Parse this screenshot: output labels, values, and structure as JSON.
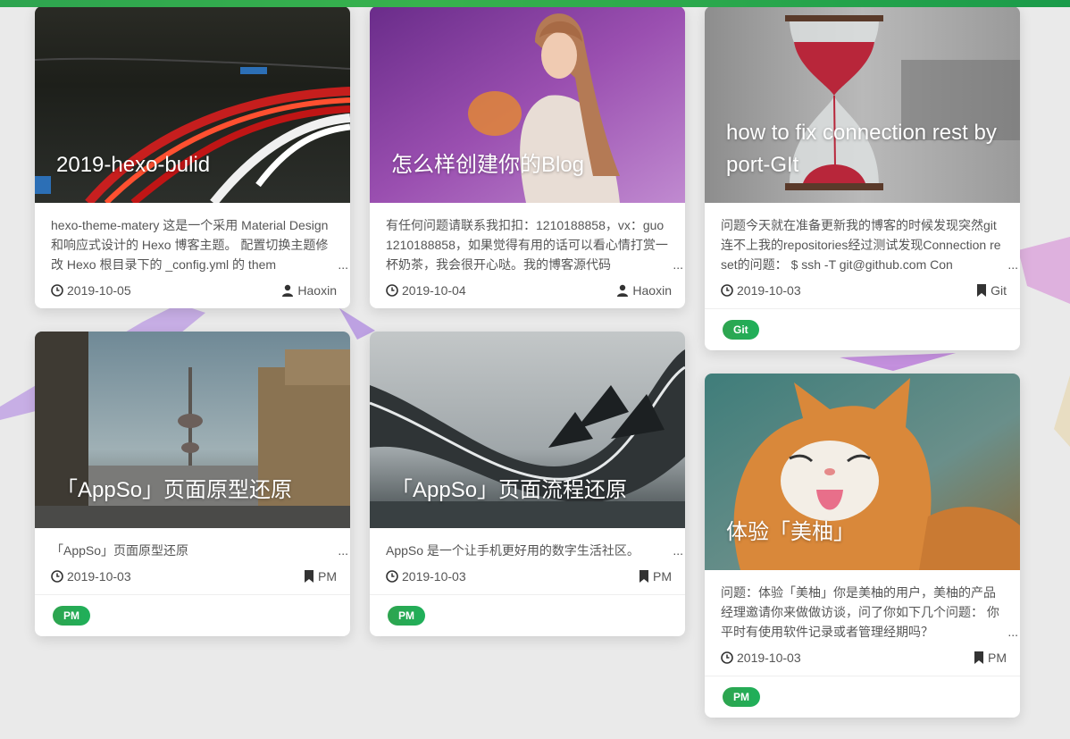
{
  "theme": {
    "accent": "#2ea44f",
    "tag_color": "#27ae60"
  },
  "cards": [
    {
      "title": "2019-hexo-bulid",
      "excerpt": "hexo-theme-matery 这是一个采用 Material Design 和响应式设计的 Hexo 博客主题。 配置切换主题修改 Hexo 根目录下的 _config.yml 的 them",
      "date": "2019-10-05",
      "meta_right": "Haoxin",
      "meta_icon": "user-icon",
      "tags": []
    },
    {
      "title": "怎么样创建你的Blog",
      "excerpt": "有任何问题请联系我扣扣：1210188858，vx：guo1210188858，如果觉得有用的话可以看心情打赏一杯奶茶，我会很开心哒。我的博客源代码",
      "date": "2019-10-04",
      "meta_right": "Haoxin",
      "meta_icon": "user-icon",
      "tags": []
    },
    {
      "title": "how to fix connection rest by port-GIt",
      "excerpt": "问题今天就在准备更新我的博客的时候发现突然git连不上我的repositories经过测试发现Connection reset的问题： $ ssh -T git@github.com Con",
      "date": "2019-10-03",
      "meta_right": "Git",
      "meta_icon": "bookmark-icon",
      "tags": [
        "Git"
      ]
    },
    {
      "title": "「AppSo」页面原型还原",
      "excerpt": "「AppSo」页面原型还原",
      "date": "2019-10-03",
      "meta_right": "PM",
      "meta_icon": "bookmark-icon",
      "tags": [
        "PM"
      ]
    },
    {
      "title": "「AppSo」页面流程还原",
      "excerpt": "AppSo 是一个让手机更好用的数字生活社区。",
      "date": "2019-10-03",
      "meta_right": "PM",
      "meta_icon": "bookmark-icon",
      "tags": [
        "PM"
      ]
    },
    {
      "title": "体验「美柚」",
      "excerpt": "问题：体验「美柚」你是美柚的用户，美柚的产品经理邀请你来做做访谈，问了你如下几个问题： 你平时有使用软件记录或者管理经期吗？",
      "date": "2019-10-03",
      "meta_right": "PM",
      "meta_icon": "bookmark-icon",
      "tags": [
        "PM"
      ]
    }
  ],
  "ellipsis": "..."
}
